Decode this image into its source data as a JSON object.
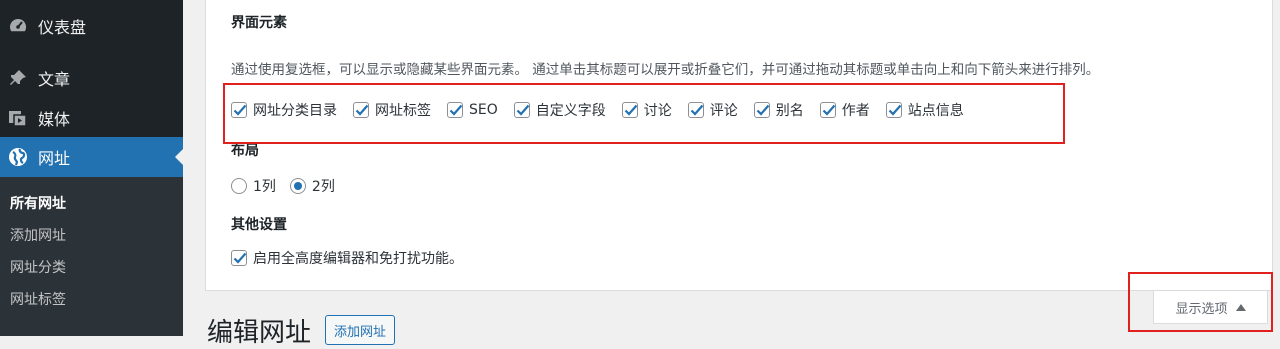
{
  "sidebar": {
    "items": [
      {
        "label": "仪表盘",
        "icon": "dashboard-icon"
      },
      {
        "label": "文章",
        "icon": "pin-icon"
      },
      {
        "label": "媒体",
        "icon": "media-icon"
      },
      {
        "label": "网址",
        "icon": "globe-icon",
        "active": true
      }
    ],
    "submenu": [
      {
        "label": "所有网址",
        "current": true
      },
      {
        "label": "添加网址"
      },
      {
        "label": "网址分类"
      },
      {
        "label": "网址标签"
      }
    ]
  },
  "screen_options": {
    "boxes_title": "界面元素",
    "boxes_desc": "通过使用复选框，可以显示或隐藏某些界面元素。 通过单击其标题可以展开或折叠它们，并可通过拖动其标题或单击向上和向下箭头来进行排列。",
    "boxes": [
      {
        "label": "网址分类目录",
        "checked": true
      },
      {
        "label": "网址标签",
        "checked": true
      },
      {
        "label": "SEO",
        "checked": true
      },
      {
        "label": "自定义字段",
        "checked": true
      },
      {
        "label": "讨论",
        "checked": true
      },
      {
        "label": "评论",
        "checked": true
      },
      {
        "label": "别名",
        "checked": true
      },
      {
        "label": "作者",
        "checked": true
      },
      {
        "label": "站点信息",
        "checked": true
      }
    ],
    "layout_title": "布局",
    "layout_options": [
      {
        "label": "1列",
        "selected": false
      },
      {
        "label": "2列",
        "selected": true
      }
    ],
    "other_title": "其他设置",
    "other_option": {
      "label": "启用全高度编辑器和免打扰功能。",
      "checked": true
    },
    "toggle_label": "显示选项"
  },
  "page": {
    "title": "编辑网址",
    "add_button": "添加网址"
  },
  "colors": {
    "sidebar_bg": "#1d2327",
    "accent": "#2271b1",
    "highlight": "#e0211d"
  }
}
